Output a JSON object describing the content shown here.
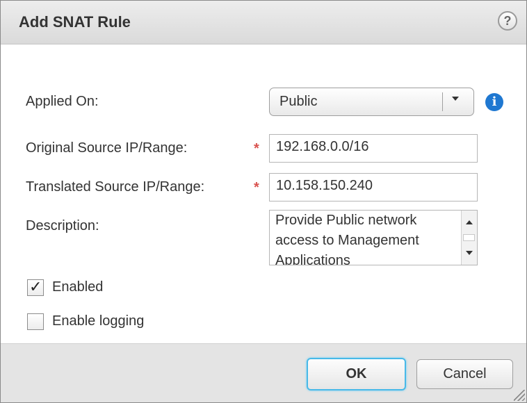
{
  "dialog": {
    "title": "Add SNAT Rule",
    "help_icon": "question-mark-icon",
    "help_glyph": "?"
  },
  "form": {
    "applied_on": {
      "label": "Applied On:",
      "value": "Public",
      "info_icon": "info-icon",
      "info_glyph": "i"
    },
    "original_source": {
      "label": "Original Source IP/Range:",
      "required_marker": "*",
      "value": "192.168.0.0/16"
    },
    "translated_source": {
      "label": "Translated Source IP/Range:",
      "required_marker": "*",
      "value": "10.158.150.240"
    },
    "description": {
      "label": "Description:",
      "value": "Provide Public network access to Management Applications"
    },
    "enabled": {
      "label": "Enabled",
      "checked": true,
      "check_glyph": "✓"
    },
    "enable_logging": {
      "label": "Enable logging",
      "checked": false
    }
  },
  "footer": {
    "ok_label": "OK",
    "cancel_label": "Cancel"
  },
  "colors": {
    "required": "#d9534f",
    "info": "#1f78d1",
    "focus_ring": "#48b9e8"
  }
}
